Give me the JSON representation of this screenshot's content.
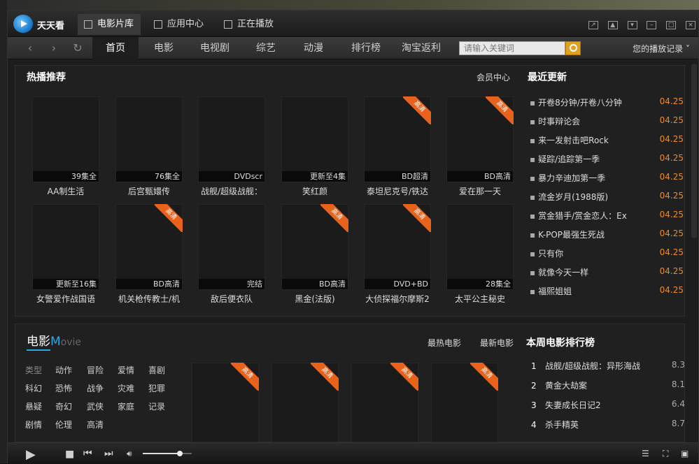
{
  "app": {
    "title": "天天看"
  },
  "top_tabs": [
    {
      "label": "电影片库",
      "active": true
    },
    {
      "label": "应用中心",
      "active": false
    },
    {
      "label": "正在播放",
      "active": false
    }
  ],
  "nav": {
    "tabs": [
      "首页",
      "电影",
      "电视剧",
      "综艺",
      "动漫",
      "排行榜",
      "淘宝返利"
    ],
    "active_index": 0,
    "search_placeholder": "请输入关键词",
    "history_label": "您的播放记录"
  },
  "hot": {
    "title": "热播推荐",
    "member_link": "会员中心",
    "items": [
      {
        "title": "AA制生活",
        "badge": "39集全",
        "hd": false
      },
      {
        "title": "后宫甄嬛传",
        "badge": "76集全",
        "hd": false
      },
      {
        "title": "战舰/超级战舰：",
        "badge": "DVDscr",
        "hd": false
      },
      {
        "title": "笑红颜",
        "badge": "更新至4集",
        "hd": false
      },
      {
        "title": "泰坦尼克号/铁达",
        "badge": "BD超清",
        "hd": true
      },
      {
        "title": "爱在那一天",
        "badge": "BD高清",
        "hd": true
      },
      {
        "title": "女警爱作战国语",
        "badge": "更新至16集",
        "hd": false
      },
      {
        "title": "机关枪传教士/机",
        "badge": "BD高清",
        "hd": true
      },
      {
        "title": "敌后便衣队",
        "badge": "完结",
        "hd": false
      },
      {
        "title": "黑金(法版)",
        "badge": "BD高清",
        "hd": true
      },
      {
        "title": "大侦探福尔摩斯2",
        "badge": "DVD+BD",
        "hd": true
      },
      {
        "title": "太平公主秘史",
        "badge": "28集全",
        "hd": false
      }
    ],
    "ribbon_label": "高清"
  },
  "recent": {
    "title": "最近更新",
    "items": [
      {
        "title": "开卷8分钟/开卷八分钟",
        "date": "04.25"
      },
      {
        "title": "时事辩论会",
        "date": "04.25"
      },
      {
        "title": "来一发射击吧Rock",
        "date": "04.25"
      },
      {
        "title": "疑踪/追踪第一季",
        "date": "04.25"
      },
      {
        "title": "暴力辛迪加第一季",
        "date": "04.25"
      },
      {
        "title": "流金岁月(1988版)",
        "date": "04.25"
      },
      {
        "title": "赏金猎手/赏金恋人：Ex",
        "date": "04.25"
      },
      {
        "title": "K-POP最强生死战",
        "date": "04.25"
      },
      {
        "title": "只有你",
        "date": "04.25"
      },
      {
        "title": "就像今天一样",
        "date": "04.25"
      },
      {
        "title": "福熙姐姐",
        "date": "04.25"
      }
    ]
  },
  "movie": {
    "title_cn": "电影",
    "title_en_first": "M",
    "title_en_rest": "ovie",
    "link_hot": "最热电影",
    "link_new": "最新电影",
    "genres": [
      [
        "类型",
        "动作",
        "冒险",
        "爱情",
        "喜剧"
      ],
      [
        "科幻",
        "恐怖",
        "战争",
        "灾难",
        "犯罪"
      ],
      [
        "悬疑",
        "奇幻",
        "武侠",
        "家庭",
        "记录"
      ],
      [
        "剧情",
        "伦理",
        "高清"
      ]
    ]
  },
  "ranking": {
    "title": "本周电影排行榜",
    "items": [
      {
        "rank": "1",
        "title": "战舰/超级战舰：异形海战",
        "score": "8.3"
      },
      {
        "rank": "2",
        "title": "黄金大劫案",
        "score": "8.1"
      },
      {
        "rank": "3",
        "title": "失妻成长日记2",
        "score": "6.4"
      },
      {
        "rank": "4",
        "title": "杀手精英",
        "score": "8.7"
      }
    ]
  },
  "player": {
    "volume": 0.75
  }
}
